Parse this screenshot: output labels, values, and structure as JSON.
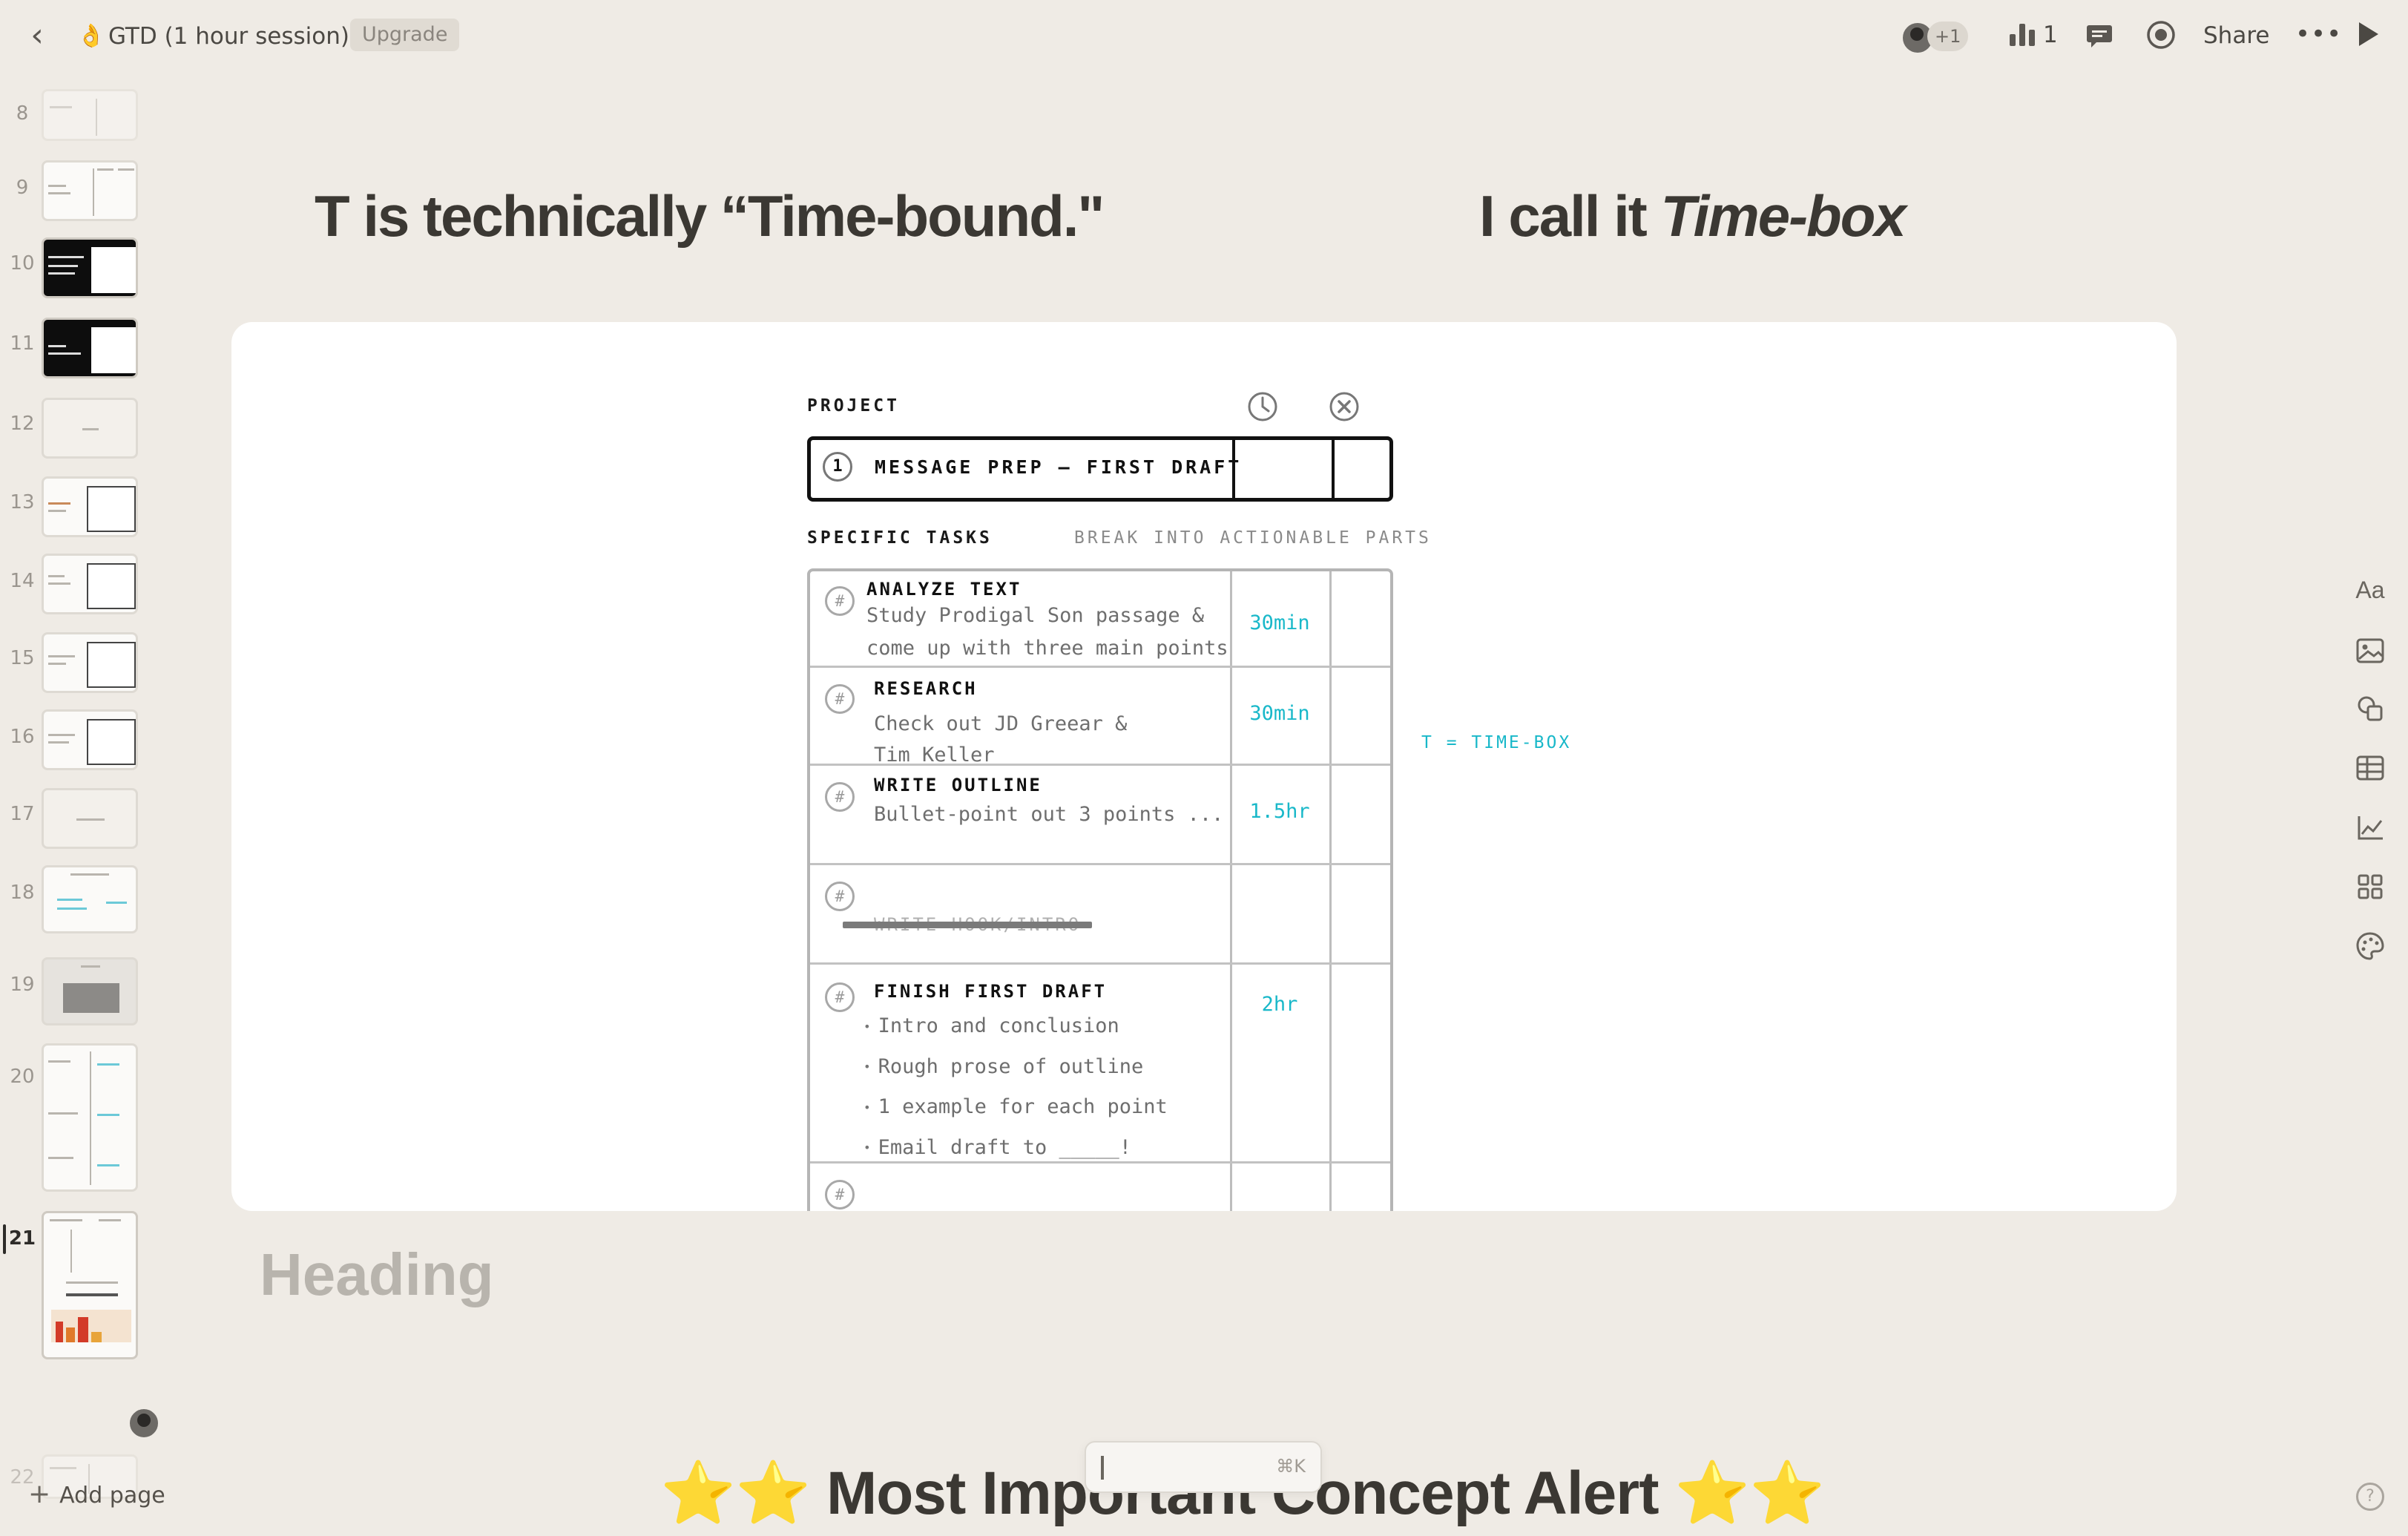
{
  "topbar": {
    "doc_emoji": "👌",
    "doc_title": "GTD (1 hour session)",
    "upgrade_label": "Upgrade",
    "collaborators_more": "+1",
    "analytics_count": "1",
    "share_label": "Share"
  },
  "sidebar": {
    "page_numbers": [
      "8",
      "9",
      "10",
      "11",
      "12",
      "13",
      "14",
      "15",
      "16",
      "17",
      "18",
      "19",
      "20",
      "21",
      "22"
    ],
    "active_page": "21",
    "add_page_label": "Add page"
  },
  "slide": {
    "heading_left": "T is technically “Time-bound.\"",
    "heading_right_prefix": "I call it ",
    "heading_right_emphasis": "Time-box",
    "project_label": "PROJECT",
    "project_number": "1",
    "project_name": "MESSAGE PREP – FIRST DRAFT",
    "specific_tasks_label": "SPECIFIC TASKS",
    "specific_tasks_hint": "BREAK INTO ACTIONABLE PARTS",
    "hash_symbol": "#",
    "tasks": [
      {
        "title": "ANALYZE TEXT",
        "desc_lines": [
          "Study Prodigal Son passage &",
          "come up with three main points"
        ],
        "time": "30min"
      },
      {
        "title": "RESEARCH",
        "desc_lines": [
          "Check out JD Greear &",
          "Tim Keller"
        ],
        "time": "30min"
      },
      {
        "title": "WRITE OUTLINE",
        "desc_lines": [
          "Bullet-point out 3 points ..."
        ],
        "time": "1.5hr"
      },
      {
        "title": "WRITE HOOK/INTRO",
        "desc_lines": [],
        "time": ""
      },
      {
        "title": "FINISH FIRST DRAFT",
        "bullets": [
          "Intro and conclusion",
          "Rough prose of outline",
          "1 example for each point",
          "Email draft to _____!"
        ],
        "time": "2hr"
      }
    ],
    "timebox_note": "T = TIME-BOX",
    "sub_heading": "Heading",
    "bottom_heading": "⭐⭐ Most Important Concept Alert ⭐⭐",
    "command_hint": "⌘K"
  },
  "rail": {
    "text_tool_label": "Aa"
  },
  "colors": {
    "background": "#efebe5",
    "accent_cyan": "#19b8c9",
    "heading": "#3b3833"
  }
}
